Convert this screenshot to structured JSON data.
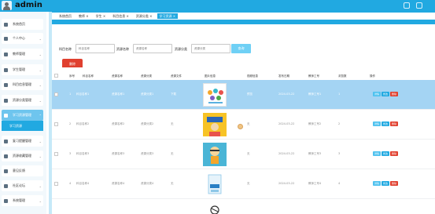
{
  "header": {
    "user_name": "admin",
    "bg_color": "#21a9e1"
  },
  "sidebar": {
    "items": [
      {
        "label": "系统首页",
        "icon": "home-icon",
        "has_children": false
      },
      {
        "label": "个人中心",
        "icon": "user-icon",
        "has_children": true
      },
      {
        "label": "教师管理",
        "icon": "teacher-icon",
        "has_children": true
      },
      {
        "label": "学生管理",
        "icon": "student-icon",
        "has_children": true
      },
      {
        "label": "科目信息管理",
        "icon": "book-icon",
        "has_children": true
      },
      {
        "label": "资源分类管理",
        "icon": "folder-icon",
        "has_children": true
      },
      {
        "label": "学习资源管理",
        "icon": "resource-icon",
        "has_children": true,
        "active": true
      },
      {
        "label": "学习资源",
        "sub": true
      },
      {
        "label": "复习提醒管理",
        "icon": "bell-icon",
        "has_children": true
      },
      {
        "label": "资源收藏管理",
        "icon": "star-icon",
        "has_children": true
      },
      {
        "label": "意见反馈",
        "icon": "feedback-icon",
        "has_children": false
      },
      {
        "label": "社区论坛",
        "icon": "forum-icon",
        "has_children": true
      },
      {
        "label": "系统管理",
        "icon": "gear-icon",
        "has_children": true
      }
    ]
  },
  "tabs": [
    {
      "label": "系统首页"
    },
    {
      "label": "教师 ×"
    },
    {
      "label": "学生 ×"
    },
    {
      "label": "科目信息 ×"
    },
    {
      "label": "资源分类 ×"
    },
    {
      "label": "学习资源 ×",
      "active": true
    }
  ],
  "search": {
    "fields": [
      {
        "label": "科目名称",
        "placeholder": "科目名称"
      },
      {
        "label": "资源名称",
        "placeholder": "资源名称"
      },
      {
        "label": "资源分类",
        "placeholder": "资源分类"
      }
    ],
    "query_label": "查询",
    "delete_label": "删除"
  },
  "table": {
    "headers": [
      "序号",
      "科目名称",
      "资源名称",
      "资源分类",
      "资源文件",
      "图片信息",
      "视频信息",
      "发布日期",
      "教师工号",
      "浏览数",
      "操作"
    ],
    "rows": [
      {
        "index": "1",
        "subject": "科目名称1",
        "resource": "资源名称1",
        "category": "资源分类1",
        "file": "下载",
        "video": "预览",
        "date": "2024-03-22",
        "teacher": "教师工号1",
        "views": "1",
        "selected": true
      },
      {
        "index": "2",
        "subject": "科目名称2",
        "resource": "资源名称2",
        "category": "资源分类2",
        "file": "无",
        "video": "无",
        "date": "2024-03-22",
        "teacher": "教师工号2",
        "views": "2",
        "selected": false
      },
      {
        "index": "3",
        "subject": "科目名称3",
        "resource": "资源名称3",
        "category": "资源分类3",
        "file": "无",
        "video": "无",
        "date": "2024-03-22",
        "teacher": "教师工号3",
        "views": "3",
        "selected": false
      },
      {
        "index": "4",
        "subject": "科目名称4",
        "resource": "资源名称4",
        "category": "资源分类4",
        "file": "无",
        "video": "无",
        "date": "2024-03-22",
        "teacher": "教师工号4",
        "views": "4",
        "selected": false
      }
    ],
    "ops": {
      "view": "详情",
      "edit": "修改",
      "delete": "删除"
    }
  }
}
